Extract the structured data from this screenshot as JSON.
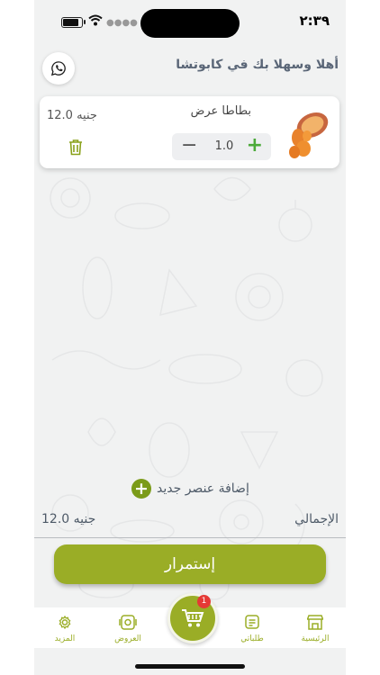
{
  "status_bar": {
    "time": "٢:٣٩"
  },
  "header": {
    "title": "أهلا وسهلا بك في كابوتشا",
    "whatsapp_icon": "whatsapp-icon"
  },
  "cart": {
    "items": [
      {
        "name": "بطاطا عرض",
        "price": "12.0 جنيه",
        "quantity": "1.0",
        "minus": "−",
        "plus": "+"
      }
    ],
    "add_new_item": "إضافة عنصر جديد",
    "add_plus": "+",
    "total_label": "الإجمالي",
    "total_value": "12.0 جنيه",
    "continue_label": "إستمرار"
  },
  "bottom_nav": {
    "items": [
      {
        "label": "الرئيسية",
        "icon": "store-icon"
      },
      {
        "label": "طلباتي",
        "icon": "orders-icon"
      },
      {
        "label": "العروض",
        "icon": "offers-icon"
      },
      {
        "label": "المزيد",
        "icon": "gear-icon"
      }
    ],
    "cart_badge": "1"
  },
  "colors": {
    "accent": "#9aad26",
    "plus_green": "#4caa3a",
    "badge_red": "#e53935",
    "background": "#f1f2f2"
  }
}
